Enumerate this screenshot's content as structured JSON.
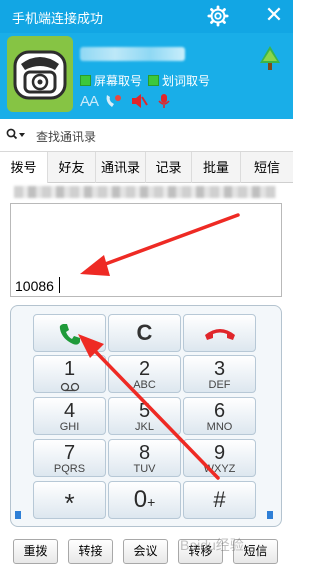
{
  "window": {
    "title": "手机端连接成功",
    "settings_icon": "gear-icon",
    "close_icon": "close-icon",
    "accent": "#12a6e4"
  },
  "header": {
    "checkbox_screen": "屏幕取号",
    "checkbox_word": "划词取号",
    "font_label": "AA"
  },
  "search": {
    "placeholder": "查找通讯录"
  },
  "tabs": [
    {
      "label": "拨号",
      "active": true
    },
    {
      "label": "好友"
    },
    {
      "label": "通讯录"
    },
    {
      "label": "记录"
    },
    {
      "label": "批量"
    },
    {
      "label": "短信"
    }
  ],
  "display": {
    "number": "10086"
  },
  "keypad": {
    "call_icon": "phone-call-icon",
    "clear_label": "C",
    "hangup_icon": "phone-hangup-icon",
    "keys": [
      {
        "digit": "1",
        "letters": "voicemail-icon"
      },
      {
        "digit": "2",
        "letters": "ABC"
      },
      {
        "digit": "3",
        "letters": "DEF"
      },
      {
        "digit": "4",
        "letters": "GHI"
      },
      {
        "digit": "5",
        "letters": "JKL"
      },
      {
        "digit": "6",
        "letters": "MNO"
      },
      {
        "digit": "7",
        "letters": "PQRS"
      },
      {
        "digit": "8",
        "letters": "TUV"
      },
      {
        "digit": "9",
        "letters": "WXYZ"
      },
      {
        "digit": "*",
        "letters": ""
      },
      {
        "digit": "0",
        "letters": "+"
      },
      {
        "digit": "#",
        "letters": ""
      }
    ]
  },
  "buttons": {
    "redial": "重拨",
    "transfer": "转接",
    "conference": "会议",
    "move": "转移",
    "sms": "短信"
  },
  "watermark": "Baidu经验",
  "colors": {
    "call_green": "#1f9a3a",
    "hangup_red": "#e0262b",
    "arrow_red": "#ee2a24"
  }
}
